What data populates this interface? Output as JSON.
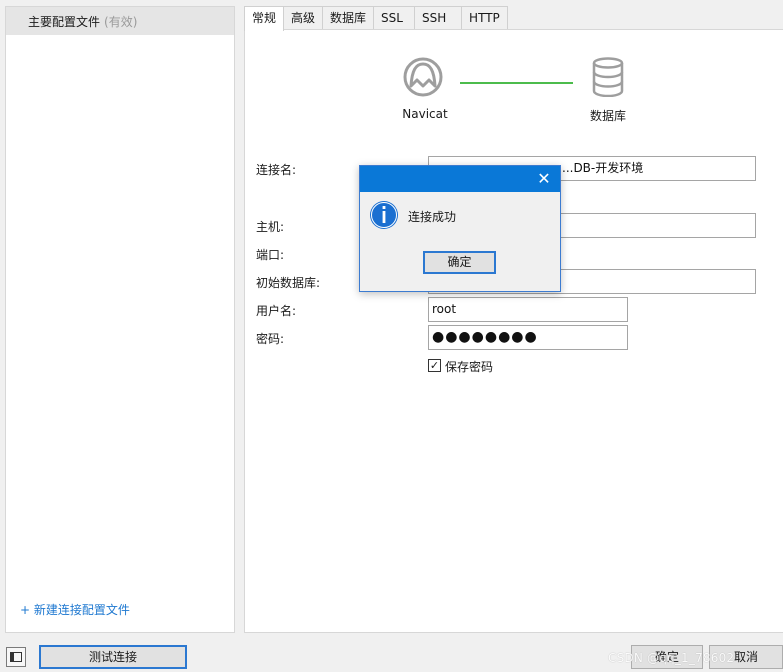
{
  "sidebar": {
    "profile_name": "主要配置文件",
    "profile_status": "(有效)",
    "new_profile": "+ 新建连接配置文件"
  },
  "tabs": [
    "常规",
    "高级",
    "数据库",
    "SSL",
    "SSH",
    "HTTP"
  ],
  "diagram": {
    "navicat_label": "Navicat",
    "database_label": "数据库"
  },
  "form": {
    "connection_name_label": "连接名:",
    "connection_name_value": "...DB-开发环境",
    "host_label": "主机:",
    "port_label": "端口:",
    "initial_db_label": "初始数据库:",
    "username_label": "用户名:",
    "username_value": "root",
    "password_label": "密码:",
    "password_value": "●●●●●●●●",
    "save_password_label": "保存密码",
    "save_password_checked": true
  },
  "footer": {
    "test_button": "测试连接",
    "ok_button": "确定",
    "cancel_button": "取消",
    "watermark": "CSDN @qq_1_78602"
  },
  "dialog": {
    "message": "连接成功",
    "ok_button": "确定"
  },
  "colors": {
    "accent_blue": "#0a78d7",
    "link_blue": "#1e78d0",
    "connector_green": "#4cbc4c"
  }
}
